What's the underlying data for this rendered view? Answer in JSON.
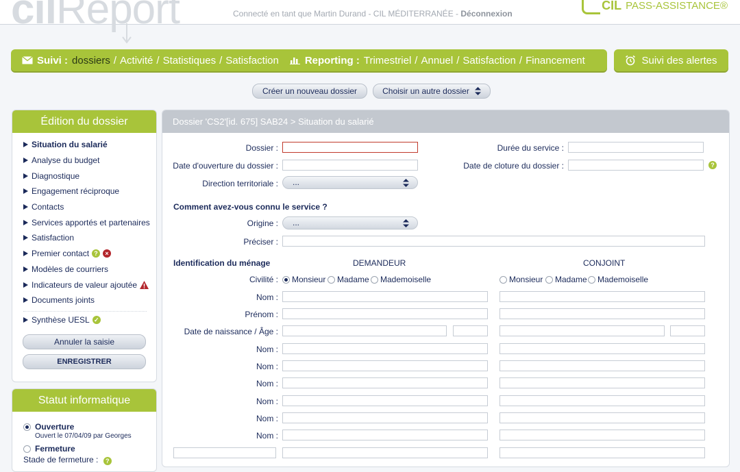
{
  "header": {
    "logo_text_cil": "cil",
    "logo_text_report": "Report",
    "login_text": "Connecté en tant que Martin Durand - CIL MÉDITERRANÉE - ",
    "logout_label": "Déconnexion",
    "brand_cil": "CIL",
    "brand_pass": "PASS-ASSISTANCE®"
  },
  "nav": {
    "suivi_title": "Suivi :",
    "suivi_items": [
      "dossiers",
      "Activité",
      "Statistiques",
      "Satisfaction"
    ],
    "reporting_title": "Reporting :",
    "reporting_items": [
      "Trimestriel",
      "Annuel",
      "Satisfaction",
      "Financement"
    ],
    "alerts_label": "Suivi des alertes",
    "separator": "/"
  },
  "actions": {
    "new_file": "Créer un nouveau dossier",
    "choose_file": "Choisir un autre dossier"
  },
  "edition": {
    "title": "Édition du dossier",
    "items": [
      "Situation du salarié",
      "Analyse du budget",
      "Diagnostique",
      "Engagement réciproque",
      "Contacts",
      "Services apportés et partenaires",
      "Satisfaction",
      "Premier contact",
      "Modèles de courriers",
      "Indicateurs de valeur ajoutée",
      "Documents joints",
      "Synthèse UESL"
    ],
    "cancel_label": "Annuler la saisie",
    "save_label": "ENREGISTRER"
  },
  "status": {
    "title": "Statut informatique",
    "opening_label": "Ouverture",
    "opening_detail": "Ouvert le 07/04/09 par Georges",
    "closing_label": "Fermeture",
    "closing_stage": "Stade de fermeture :"
  },
  "main": {
    "breadcrumb": "Dossier 'CS2'[id. 675] SAB24 > Situation du salarié",
    "labels": {
      "dossier": "Dossier :",
      "date_ouverture": "Date d'ouverture du dossier :",
      "direction": "Direction territoriale :",
      "duree": "Durée du service :",
      "date_cloture": "Date de cloture du dossier :",
      "origine": "Origine :",
      "preciser": "Préciser :",
      "civilite": "Civilité :",
      "nom": "Nom :",
      "prenom": "Prénom :",
      "naissance": "Date de naissance / Âge :"
    },
    "direction_value": "...",
    "origine_value": "...",
    "section_connu": "Comment avez-vous connu le service ?",
    "section_menage": "Identification du ménage",
    "col_demandeur": "DEMANDEUR",
    "col_conjoint": "CONJOINT",
    "civilite_options": [
      "Monsieur",
      "Madame",
      "Mademoiselle"
    ],
    "help_symbol": "?"
  },
  "colors": {
    "accent": "#a8c43a",
    "navy": "#1b2a5a",
    "header_grey": "#c3c8cf",
    "error": "#c0392b"
  }
}
